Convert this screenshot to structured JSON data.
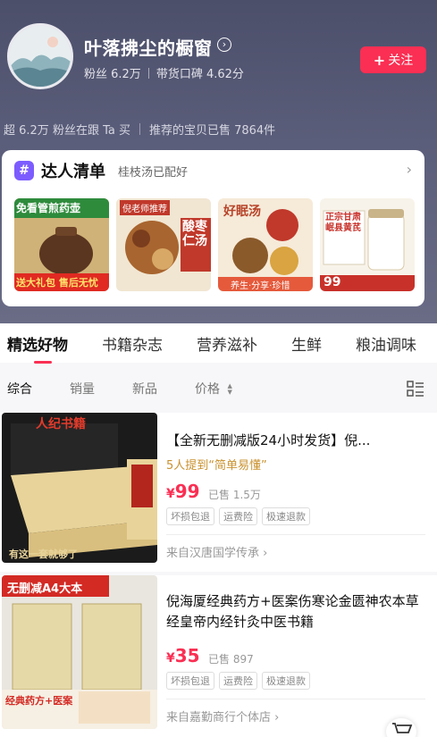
{
  "header": {
    "shop_name": "叶落拂尘的橱窗",
    "fans": "粉丝 6.2万",
    "rating": "带货口碑 4.62分",
    "follow_label": "关注",
    "followers_buying": "超 6.2万 粉丝在跟 Ta 买",
    "sold_summary": "推荐的宝贝已售 7864件"
  },
  "curated": {
    "title": "达人清单",
    "subtitle": "桂枝汤已配好",
    "items": [
      {
        "line1": "免看管煎药壶",
        "line2": "送大礼包 售后无忧"
      },
      {
        "line1": "倪老师推荐",
        "line2": "酸枣仁汤"
      },
      {
        "line1": "好眠汤",
        "line2": "养生·分享·珍惜"
      },
      {
        "line1": "正宗甘肃 岷县黄芪",
        "line2": "99"
      }
    ]
  },
  "tabs": [
    "精选好物",
    "书籍杂志",
    "营养滋补",
    "生鲜",
    "粮油调味"
  ],
  "filters": [
    "综合",
    "销量",
    "新品",
    "价格"
  ],
  "products": [
    {
      "title": "【全新无删减版24小时发货】倪...",
      "recommend": "5人提到“简单易懂”",
      "currency": "¥",
      "price": "99",
      "sold": "已售 1.5万",
      "tags": [
        "坏损包退",
        "运费险",
        "极速退款"
      ],
      "store": "来自汉唐国学传承",
      "cover_top": "人纪书籍",
      "cover_bottom": "有这一套就够了"
    },
    {
      "title": "倪海厦经典药方+医案伤寒论金匮神农本草经皇帝内经针灸中医书籍",
      "currency": "¥",
      "price": "35",
      "sold": "已售 897",
      "tags": [
        "坏损包退",
        "运费险",
        "极速退款"
      ],
      "store": "来自嘉勤商行个体店",
      "cover_top": "无删减A4大本",
      "cover_bottom": "经典药方+医案"
    }
  ]
}
